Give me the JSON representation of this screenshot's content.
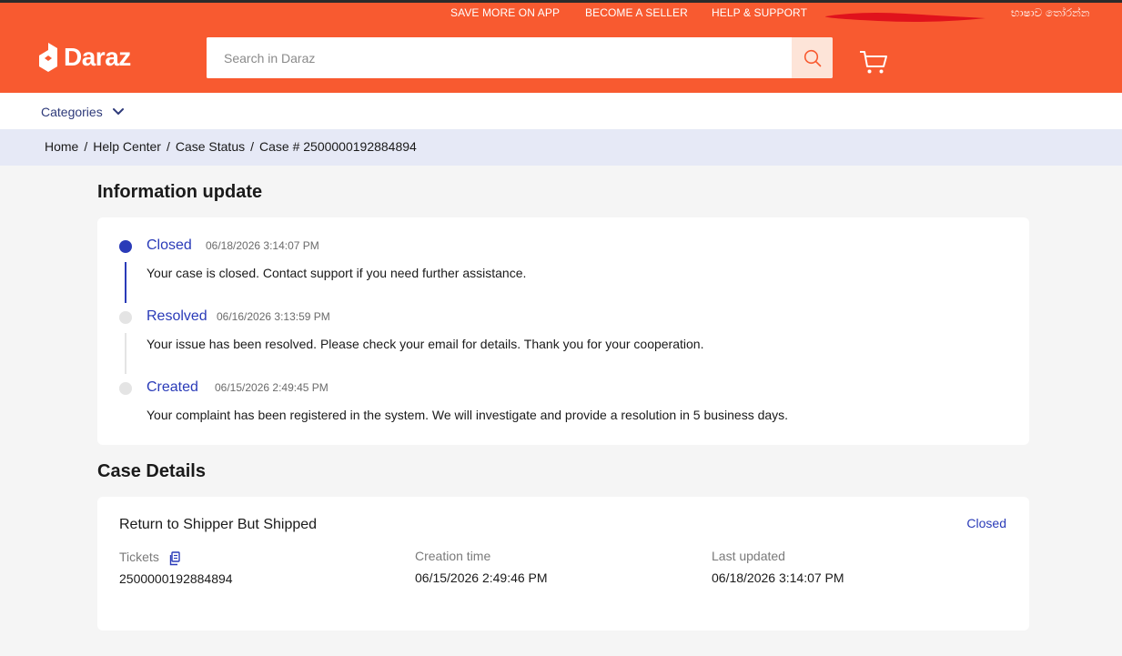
{
  "colors": {
    "brand": "#f85a30",
    "accent": "#2a3bb8",
    "breadcrumb_bg": "#e6e9f6"
  },
  "toplinks": {
    "save_more": "SAVE MORE ON APP",
    "become_seller": "BECOME A SELLER",
    "help_support": "HELP & SUPPORT",
    "language": "භාෂාව තෝරන්න"
  },
  "header": {
    "logo_text": "Daraz",
    "search_placeholder": "Search in Daraz",
    "search_icon": "search-icon",
    "cart_icon": "cart-icon"
  },
  "nav": {
    "categories_label": "Categories"
  },
  "breadcrumb": {
    "home": "Home",
    "help_center": "Help Center",
    "case_status": "Case Status",
    "case": "Case # 2500000192884894"
  },
  "info_update": {
    "title": "Information update",
    "events": [
      {
        "status": "Closed",
        "time": "06/18/2026 3:14:07 PM",
        "description": "Your case is closed. Contact support if you need further assistance."
      },
      {
        "status": "Resolved",
        "time": "06/16/2026 3:13:59 PM",
        "description": "Your issue has been resolved. Please check your email for details. Thank you for your cooperation."
      },
      {
        "status": "Created",
        "time": "06/15/2026 2:49:45 PM",
        "description": "Your complaint has been registered in the system. We will investigate and provide a resolution in 5 business days."
      }
    ]
  },
  "case_details": {
    "title": "Case Details",
    "case_type": "Return to Shipper But Shipped",
    "status": "Closed",
    "tickets_label": "Tickets",
    "tickets_value": "2500000192884894",
    "creation_label": "Creation time",
    "creation_value": "06/15/2026 2:49:46 PM",
    "updated_label": "Last updated",
    "updated_value": "06/18/2026 3:14:07 PM"
  }
}
